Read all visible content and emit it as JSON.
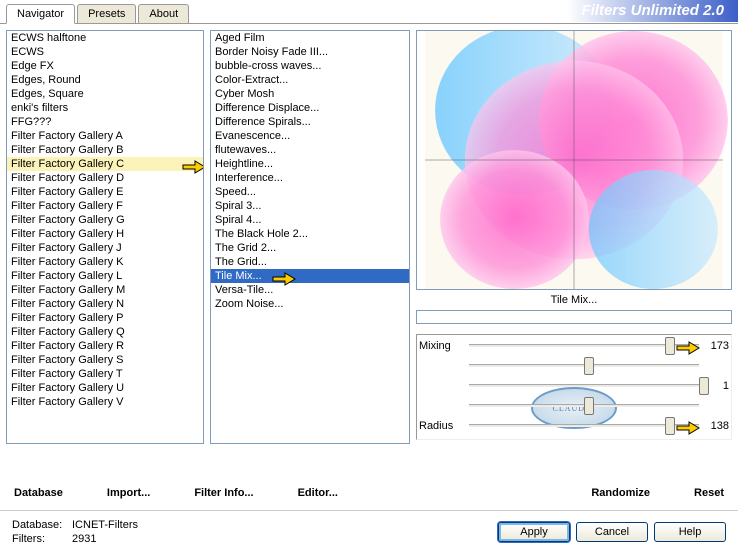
{
  "app_title": "Filters Unlimited 2.0",
  "tabs": [
    {
      "label": "Navigator",
      "active": true
    },
    {
      "label": "Presets",
      "active": false
    },
    {
      "label": "About",
      "active": false
    }
  ],
  "categories": [
    "ECWS halftone",
    "ECWS",
    "Edge FX",
    "Edges, Round",
    "Edges, Square",
    "enki's filters",
    "FFG???",
    "Filter Factory Gallery A",
    "Filter Factory Gallery B",
    "Filter Factory Gallery C",
    "Filter Factory Gallery D",
    "Filter Factory Gallery E",
    "Filter Factory Gallery F",
    "Filter Factory Gallery G",
    "Filter Factory Gallery H",
    "Filter Factory Gallery J",
    "Filter Factory Gallery K",
    "Filter Factory Gallery L",
    "Filter Factory Gallery M",
    "Filter Factory Gallery N",
    "Filter Factory Gallery P",
    "Filter Factory Gallery Q",
    "Filter Factory Gallery R",
    "Filter Factory Gallery S",
    "Filter Factory Gallery T",
    "Filter Factory Gallery U",
    "Filter Factory Gallery V"
  ],
  "category_highlighted_index": 9,
  "filters": [
    "Aged Film",
    "Border Noisy Fade III...",
    "bubble-cross waves...",
    "Color-Extract...",
    "Cyber Mosh",
    "Difference Displace...",
    "Difference Spirals...",
    "Evanescence...",
    "flutewaves...",
    "Heightline...",
    "Interference...",
    "Speed...",
    "Spiral 3...",
    "Spiral 4...",
    "The Black Hole 2...",
    "The Grid 2...",
    "The Grid...",
    "Tile Mix...",
    "Versa-Tile...",
    "Zoom Noise..."
  ],
  "filter_selected_index": 17,
  "current_filter_label": "Tile Mix...",
  "sliders": [
    {
      "label": "Mixing",
      "value": 173,
      "max": 255,
      "pos": 85
    },
    {
      "label": "",
      "value": "",
      "max": 255,
      "pos": 50
    },
    {
      "label": "",
      "value": 1,
      "max": 255,
      "pos": 100
    },
    {
      "label": "",
      "value": "",
      "max": 255,
      "pos": 50
    },
    {
      "label": "Radius",
      "value": 138,
      "max": 255,
      "pos": 85
    }
  ],
  "bottom_buttons_left": [
    "Database",
    "Import...",
    "Filter Info...",
    "Editor..."
  ],
  "bottom_buttons_right": [
    "Randomize",
    "Reset"
  ],
  "footer": {
    "db_label": "Database:",
    "db_value": "ICNET-Filters",
    "filters_label": "Filters:",
    "filters_value": "2931"
  },
  "action_buttons": {
    "apply": "Apply",
    "cancel": "Cancel",
    "help": "Help"
  },
  "watermark": "CLAUDIA"
}
